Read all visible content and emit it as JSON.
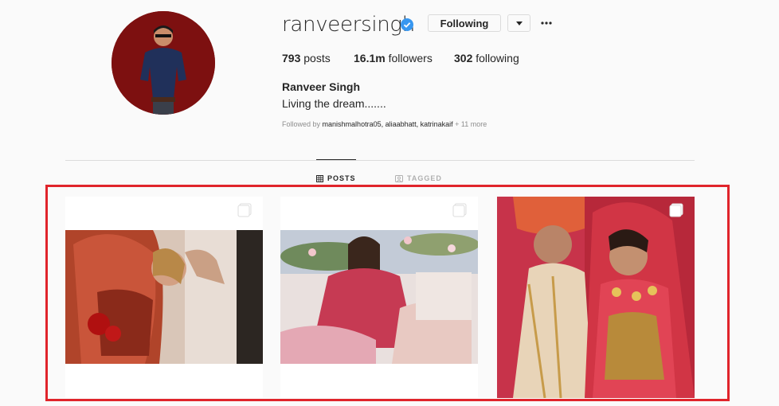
{
  "profile": {
    "username": "ranveersingh",
    "full_name": "Ranveer Singh",
    "bio": "Living the dream.......",
    "following_label": "Following",
    "followed_by_prefix": "Followed by",
    "followed_by_names": "manishmalhotra05, aliaabhatt, katrinakaif",
    "followed_by_more": "+ 11 more"
  },
  "stats": {
    "posts_count": "793",
    "posts_label": "posts",
    "followers_count": "16.1m",
    "followers_label": "followers",
    "following_count": "302",
    "following_label": "following"
  },
  "tabs": {
    "posts": "POSTS",
    "tagged": "TAGGED"
  },
  "colors": {
    "highlight": "#e0242b",
    "verified": "#3897f0",
    "avatar_bg": "#7d1010"
  },
  "icons": [
    "verified-badge-icon",
    "chevron-down-icon",
    "more-options-icon",
    "grid-icon",
    "tagged-icon",
    "multiple-posts-icon"
  ]
}
